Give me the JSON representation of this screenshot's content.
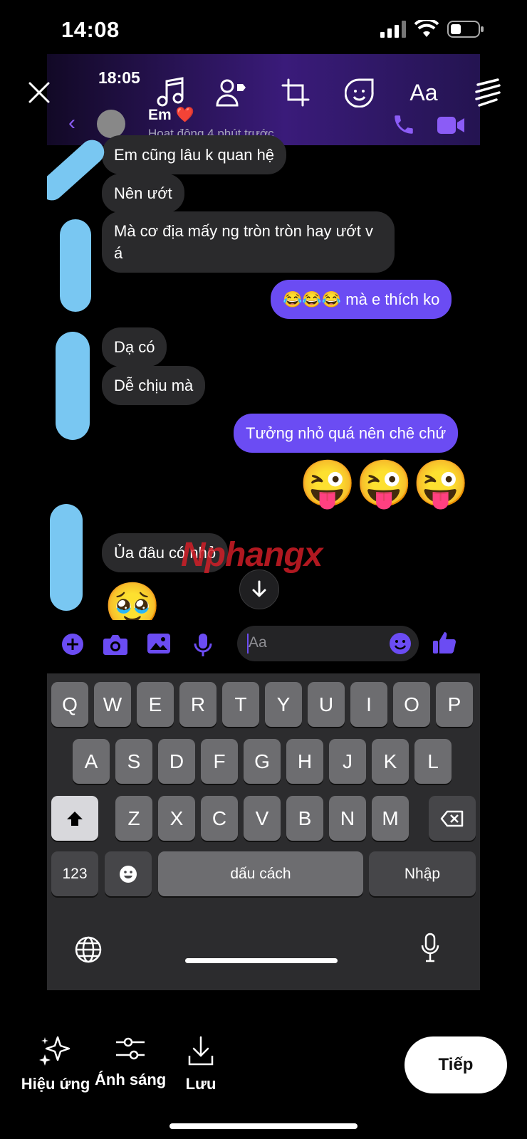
{
  "status_bar": {
    "time": "14:08"
  },
  "editor_tools": {
    "close": "close-icon",
    "music": "music-icon",
    "tag": "tag-people-icon",
    "crop": "crop-icon",
    "sticker": "sticker-icon",
    "text": "Aa",
    "draw": "draw-icon"
  },
  "screenshot": {
    "status_time": "18:05",
    "contact_name": "Em ❤️",
    "contact_status": "Hoạt động 4 phút trước",
    "messages": [
      {
        "dir": "in",
        "text": "Em cũng lâu k quan hệ"
      },
      {
        "dir": "in",
        "text": "Nên ướt"
      },
      {
        "dir": "in",
        "text": "Mà cơ địa mấy ng tròn tròn hay ướt v á"
      },
      {
        "dir": "out",
        "text": "😂😂😂 mà e thích ko"
      },
      {
        "dir": "in",
        "text": "Dạ có"
      },
      {
        "dir": "in",
        "text": "Dễ chịu mà"
      },
      {
        "dir": "out",
        "text": "Tưởng nhỏ quá nên chê chứ"
      },
      {
        "dir": "out",
        "text": "😜😜😜"
      },
      {
        "dir": "in",
        "text": "Ủa đâu có nhỏ"
      },
      {
        "dir": "in",
        "text": "🥹"
      }
    ],
    "watermark": "Nphangx",
    "composer_placeholder": "Aa",
    "keyboard": {
      "row1": [
        "Q",
        "W",
        "E",
        "R",
        "T",
        "Y",
        "U",
        "I",
        "O",
        "P"
      ],
      "row2": [
        "A",
        "S",
        "D",
        "F",
        "G",
        "H",
        "J",
        "K",
        "L"
      ],
      "row3": [
        "Z",
        "X",
        "C",
        "V",
        "B",
        "N",
        "M"
      ],
      "numbers": "123",
      "space": "dấu cách",
      "return": "Nhập"
    }
  },
  "bottom": {
    "effects": "Hiệu ứng",
    "light": "Ánh sáng",
    "save": "Lưu",
    "next": "Tiếp"
  }
}
